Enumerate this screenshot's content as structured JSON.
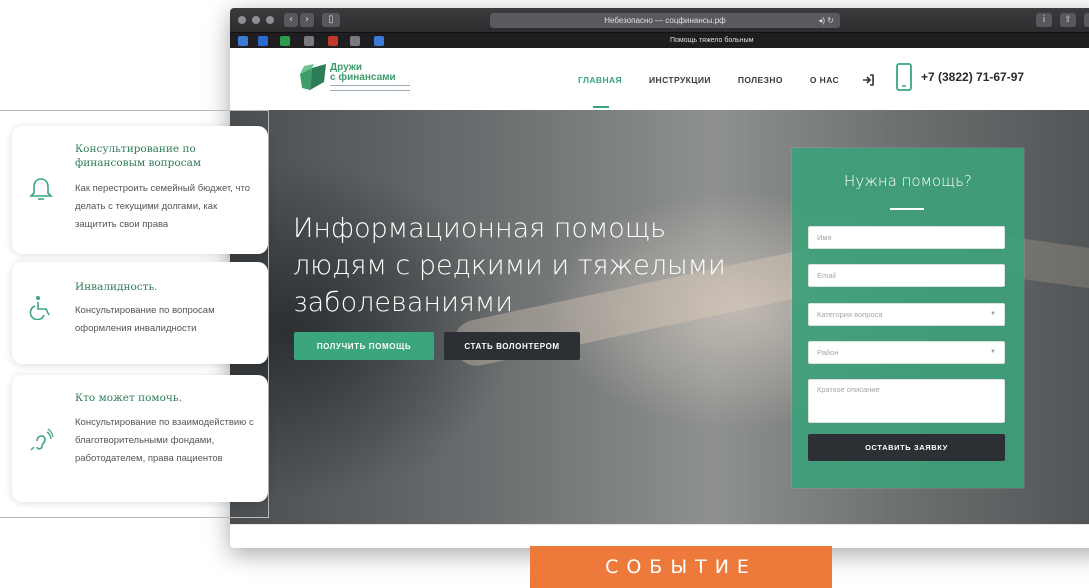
{
  "browser": {
    "address": "Небезопасно — соцфинансы.рф",
    "tab_title": "Помощь тяжело больным"
  },
  "site": {
    "logo_line1": "Дружи",
    "logo_line2": "с финансами",
    "nav": [
      {
        "label": "ГЛАВНАЯ",
        "active": true
      },
      {
        "label": "ИНСТРУКЦИИ",
        "active": false
      },
      {
        "label": "ПОЛЕЗНО",
        "active": false
      },
      {
        "label": "О НАС",
        "active": false
      }
    ],
    "phone": "+7 (3822) 71-67-97"
  },
  "hero": {
    "title": "Информационная помощь людям с редкими и тяжелыми заболеваниями",
    "help_button": "ПОЛУЧИТЬ ПОМОЩЬ",
    "volunteer_button": "СТАТЬ ВОЛОНТЕРОМ"
  },
  "form": {
    "title": "Нужна помощь?",
    "name_placeholder": "Имя",
    "email_placeholder": "Email",
    "category_placeholder": "Категория вопроса",
    "district_placeholder": "Район",
    "description_placeholder": "Краткое описание",
    "submit": "ОСТАВИТЬ ЗАЯВКУ"
  },
  "cards": [
    {
      "icon": "bell-icon",
      "title": "Консультирование по финансовым вопросам",
      "text": "Как перестроить семейный бюджет, что делать с текущими долгами, как защитить свои права"
    },
    {
      "icon": "wheelchair-icon",
      "title": "Инвалидность.",
      "text": "Консультирование по вопросам оформления инвалидности"
    },
    {
      "icon": "hearing-icon",
      "title": "Кто может помочь.",
      "text": "Консультирование по взаимодействию с благотворительными фондами, работодателем, права пациентов"
    }
  ],
  "tag": "СОБЫТИЕ",
  "colors": {
    "accent": "#3ba57d",
    "dark": "#2c3035",
    "tag": "#ed7a3a"
  }
}
